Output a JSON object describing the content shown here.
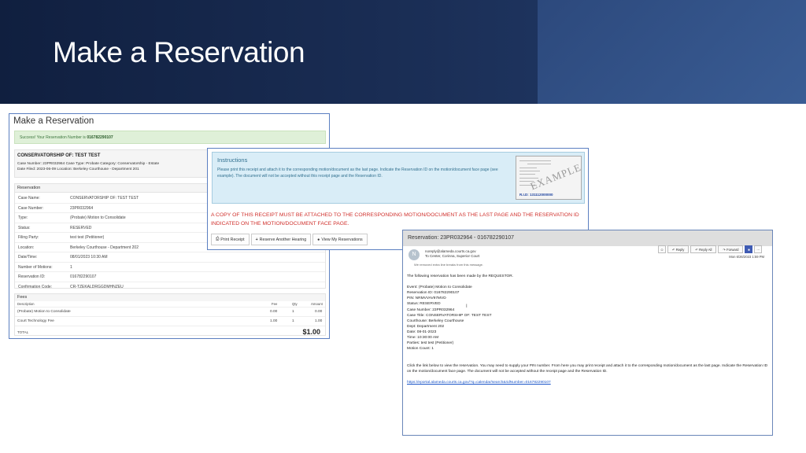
{
  "slide": {
    "title": "Make a Reservation"
  },
  "form": {
    "title": "Make a Reservation",
    "success_prefix": "Success! Your Reservation Number is ",
    "success_number": "016782290107",
    "case_title": "CONSERVATORSHIP OF: TEST TEST",
    "case_line1": "Case Number: 23PR032964    Case Type: Probate    Category: Conservatorship - Estate",
    "case_line2": "Date Filed: 2023-06-09   Location: Berkeley Courthouse - Department 201",
    "reservation_heading": "Reservation",
    "rows": [
      {
        "label": "Case Name:",
        "value": "CONSERVATORSHIP OF: TEST TEST"
      },
      {
        "label": "Case Number:",
        "value": "23PR032964"
      },
      {
        "label": "Type:",
        "value": "(Probate) Motion to Consolidate"
      },
      {
        "label": "Status:",
        "value": "RESERVED"
      },
      {
        "label": "Filing Party:",
        "value": "test test (Petitioner)"
      },
      {
        "label": "Location:",
        "value": "Berkeley Courthouse - Department 202"
      },
      {
        "label": "Date/Time:",
        "value": "08/01/2023 10:30 AM"
      },
      {
        "label": "Number of Motions:",
        "value": "1"
      },
      {
        "label": "Reservation ID:",
        "value": "016782290107"
      },
      {
        "label": "Confirmation Code:",
        "value": "CR-TZEKALDRGGDMHNZEU"
      }
    ],
    "fees_heading": "Fees",
    "fee_headers": {
      "description": "Description",
      "fee": "Fee",
      "qty": "Qty",
      "amount": "Amount"
    },
    "fees": [
      {
        "description": "(Probate) Motion to Consolidate",
        "fee": "0.00",
        "qty": "1",
        "amount": "0.00"
      },
      {
        "description": "Court Technology Fee",
        "fee": "1.00",
        "qty": "1",
        "amount": "1.00"
      }
    ],
    "total_label": "TOTAL",
    "total_value": "$1.00"
  },
  "instructions": {
    "title": "Instructions",
    "text": "Please print this receipt and attach it to the corresponding motion/document as the last page. Indicate the Reservation ID on the motion/document face page (see example). The document will not be accepted without this receipt page and the Reservation ID.",
    "example_word": "EXAMPLE",
    "example_id": "R.I.D: 131112000000",
    "warning": "A COPY OF THIS RECEIPT MUST BE ATTACHED TO THE CORRESPONDING MOTION/DOCUMENT AS THE LAST PAGE AND THE RESERVATION ID INDICATED ON THE MOTION/DOCUMENT FACE PAGE.",
    "buttons": {
      "print": "Print Receipt",
      "reserve": "Reserve Another Hearing",
      "view": "View My Reservations"
    }
  },
  "email": {
    "subject": "Reservation: 23PR032964 - 016782290107",
    "avatar_letter": "N",
    "from": "noreply@alameda.courts.ca.gov",
    "to": "To  Center, Corinna, Superior Court",
    "note": "We removed extra line breaks from this message.",
    "actions": {
      "reply": "Reply",
      "reply_all": "Reply All",
      "forward": "Forward"
    },
    "date": "Mon 6/26/2023 1:59 PM",
    "intro": "The following reservation has been made by the REQUESTOR.",
    "details": [
      "Event: (Probate) Motion to Consolidate",
      "Reservation ID: 016782290107",
      "PIN: NRMVVAV97MVD",
      "Status: RESERVED",
      "Case Number: 23PR032964",
      "Case Title: CONSERVATORSHIP OF: TEST TEST",
      "Courthouse: Berkeley Courthouse",
      "Dept: Department 202",
      "Date: 08-01-2023",
      "Time: 10:30:00 AM",
      "Parties: test test (Petitioner)",
      "Motion Count: 1"
    ],
    "link_instructions": "Click the link below to view the reservation. You may need to supply your PIN number. From here you may print receipt and attach it to the corresponding motion/document as the last page. Indicate the Reservation ID on the motion/document face page. The document will not be accepted without the receipt page and the Reservation ID.",
    "link": "https://eportal.alameda.courts.ca.gov/?q=calendar/search&ridNumber=016782290107"
  }
}
